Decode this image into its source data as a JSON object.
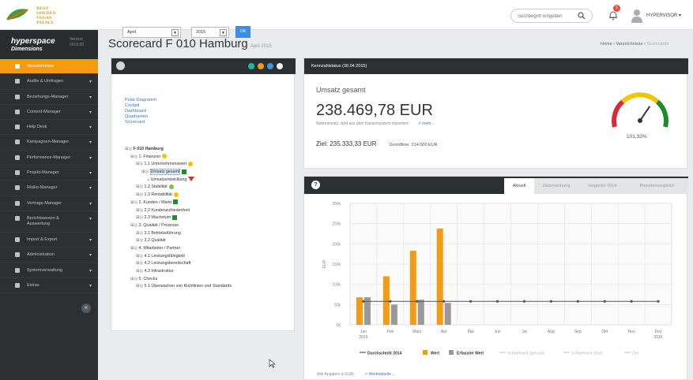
{
  "logo": {
    "lines": [
      "BEST",
      "GOLDEN",
      "VEGAS",
      "PALACE"
    ]
  },
  "search": {
    "placeholder": "Suchbegriff eingeben"
  },
  "notifications": {
    "count": "5"
  },
  "user": {
    "name": "HYPERVISOR ▾"
  },
  "brand": {
    "name": "hyperspace",
    "sub": "Dimensions",
    "version": "Version",
    "build": "2015.00"
  },
  "sidebar": {
    "items": [
      {
        "label": "Verzeichnisse",
        "icon": "warning-icon",
        "active": true
      },
      {
        "label": "Audits & Umfragen",
        "icon": "checklist-icon"
      },
      {
        "label": "Beziehungs-Manager",
        "icon": "handshake-icon"
      },
      {
        "label": "Content-Manager",
        "icon": "document-icon"
      },
      {
        "label": "Help Desk",
        "icon": "helpdesk-icon"
      },
      {
        "label": "Kampagnen-Manager",
        "icon": "megaphone-icon"
      },
      {
        "label": "Performance-Manager",
        "icon": "speedometer-icon"
      },
      {
        "label": "Projekt-Manager",
        "icon": "project-icon"
      },
      {
        "label": "Risiko-Manager",
        "icon": "risk-icon"
      },
      {
        "label": "Vertrags-Manager",
        "icon": "contract-icon"
      },
      {
        "label": "Berichtswesen & Auswertung",
        "icon": "bar-chart-icon"
      },
      {
        "label": "Import & Export",
        "icon": "import-export-icon"
      },
      {
        "label": "Administration",
        "icon": "gear-icon"
      },
      {
        "label": "Systemverwaltung",
        "icon": "gears-icon"
      },
      {
        "label": "Extras",
        "icon": "extras-icon"
      }
    ],
    "collapse": "«"
  },
  "page": {
    "title": "Scorecard F 010 Hamburg",
    "subtitle": "April 2015"
  },
  "breadcrumb": {
    "home": "Home",
    "sep1": " › ",
    "section": "Verzeichnisse",
    "sep2": " › ",
    "current": "Scorecards"
  },
  "filters": {
    "month": "April",
    "year": "2015",
    "ok": "OK"
  },
  "views": [
    "Polar-Diagramm",
    "Cockpit",
    "Dashboard",
    "Quadranten",
    "Scorecard"
  ],
  "tree": [
    {
      "label": "F 010 Hamburg",
      "indent": 0,
      "bold": true
    },
    {
      "label": "1. Finanzen",
      "indent": 1,
      "status": "yellow"
    },
    {
      "label": "1.1 Unternehmenswert",
      "indent": 2,
      "status": "yellow"
    },
    {
      "label": "Umsatz gesamt",
      "indent": 3,
      "status": "green-square",
      "selected": true
    },
    {
      "label": "Umsatzentwicklung",
      "indent": 4,
      "status": "red-down"
    },
    {
      "label": "1.2 Stabilität",
      "indent": 2,
      "status": "lightgreen"
    },
    {
      "label": "1.3 Rentabilität",
      "indent": 2,
      "status": "yellow"
    },
    {
      "label": "2. Kunden / Markt",
      "indent": 1,
      "status": "green-square"
    },
    {
      "label": "2.2 Kundenzufriedenheit",
      "indent": 2
    },
    {
      "label": "2.3 Wachstum",
      "indent": 2,
      "status": "green-square"
    },
    {
      "label": "3. Qualität / Prozesse",
      "indent": 1
    },
    {
      "label": "3.1 Betriebsführung",
      "indent": 2
    },
    {
      "label": "3.2 Qualität",
      "indent": 2
    },
    {
      "label": "4. Mitarbeiter / Partner",
      "indent": 1
    },
    {
      "label": "4.1 Leistungsfähigkeit",
      "indent": 2
    },
    {
      "label": "4.2 Leistungsbereitschaft",
      "indent": 2
    },
    {
      "label": "4.3 Infrastruktur",
      "indent": 2
    },
    {
      "label": "5. Checks",
      "indent": 1
    },
    {
      "label": "5.1 Überwachen von Richtlinien und Standards",
      "indent": 2
    }
  ],
  "kpi": {
    "header": "Kennzahlstatus (30.04.2015)",
    "label": "Umsatz gesamt",
    "value": "238.469,78 EUR",
    "note": "Nettoumsatz, wird aus dem Kassensystem importiert",
    "more": "↗ mehr...",
    "target": "Ziel: 235.333,33 EUR",
    "baseline": "Grundlinie: 214.000 EUR",
    "gauge_pct": "101,33%",
    "gauge_value": 101.33
  },
  "tabs": [
    {
      "label": "Aktuell",
      "active": true
    },
    {
      "label": "Zielerreichung"
    },
    {
      "label": "Vergleich 2014"
    },
    {
      "label": "Periodenvergleich"
    }
  ],
  "chart_data": {
    "type": "bar",
    "categories": [
      "Jan 2015",
      "Feb",
      "März",
      "Apr",
      "Mai",
      "Jun",
      "Jul",
      "Aug",
      "Sep",
      "Okt",
      "Nov",
      "Dez 2015"
    ],
    "ylabel": "EUR",
    "yticks": [
      "0k",
      "50k",
      "100k",
      "150k",
      "200k",
      "250k",
      "300k"
    ],
    "ylim": [
      0,
      300000
    ],
    "series": [
      {
        "name": "Wert",
        "type": "bar",
        "color": "#f39c12",
        "values": [
          68000,
          120000,
          183000,
          238000,
          null,
          null,
          null,
          null,
          null,
          null,
          null,
          null
        ]
      },
      {
        "name": "Erfasster Wert",
        "type": "bar",
        "color": "#999999",
        "values": [
          68000,
          50000,
          62000,
          54000,
          null,
          null,
          null,
          null,
          null,
          null,
          null,
          null
        ]
      },
      {
        "name": "Durchschnitt 2014",
        "type": "line",
        "color": "#555555",
        "values": [
          58000,
          58000,
          58000,
          58000,
          58000,
          58000,
          58000,
          58000,
          58000,
          58000,
          58000,
          58000
        ]
      }
    ],
    "legend": [
      "Durchschnitt 2014",
      "Wert",
      "Erfasster Wert",
      "Schwellwert (gesund)",
      "Schwellwert (Rot)",
      "Ziel"
    ],
    "legend_position": "bottom",
    "grid": true
  },
  "footer": {
    "note": "Alle Angaben in EUR.",
    "link": "↗ Wertetabelle ..."
  },
  "colors": {
    "accent": "#f39c12",
    "dark": "#2d3033",
    "link": "#3a75c4",
    "green": "#1e8c2a",
    "red": "#d62c3a",
    "yellow": "#f5c400"
  }
}
